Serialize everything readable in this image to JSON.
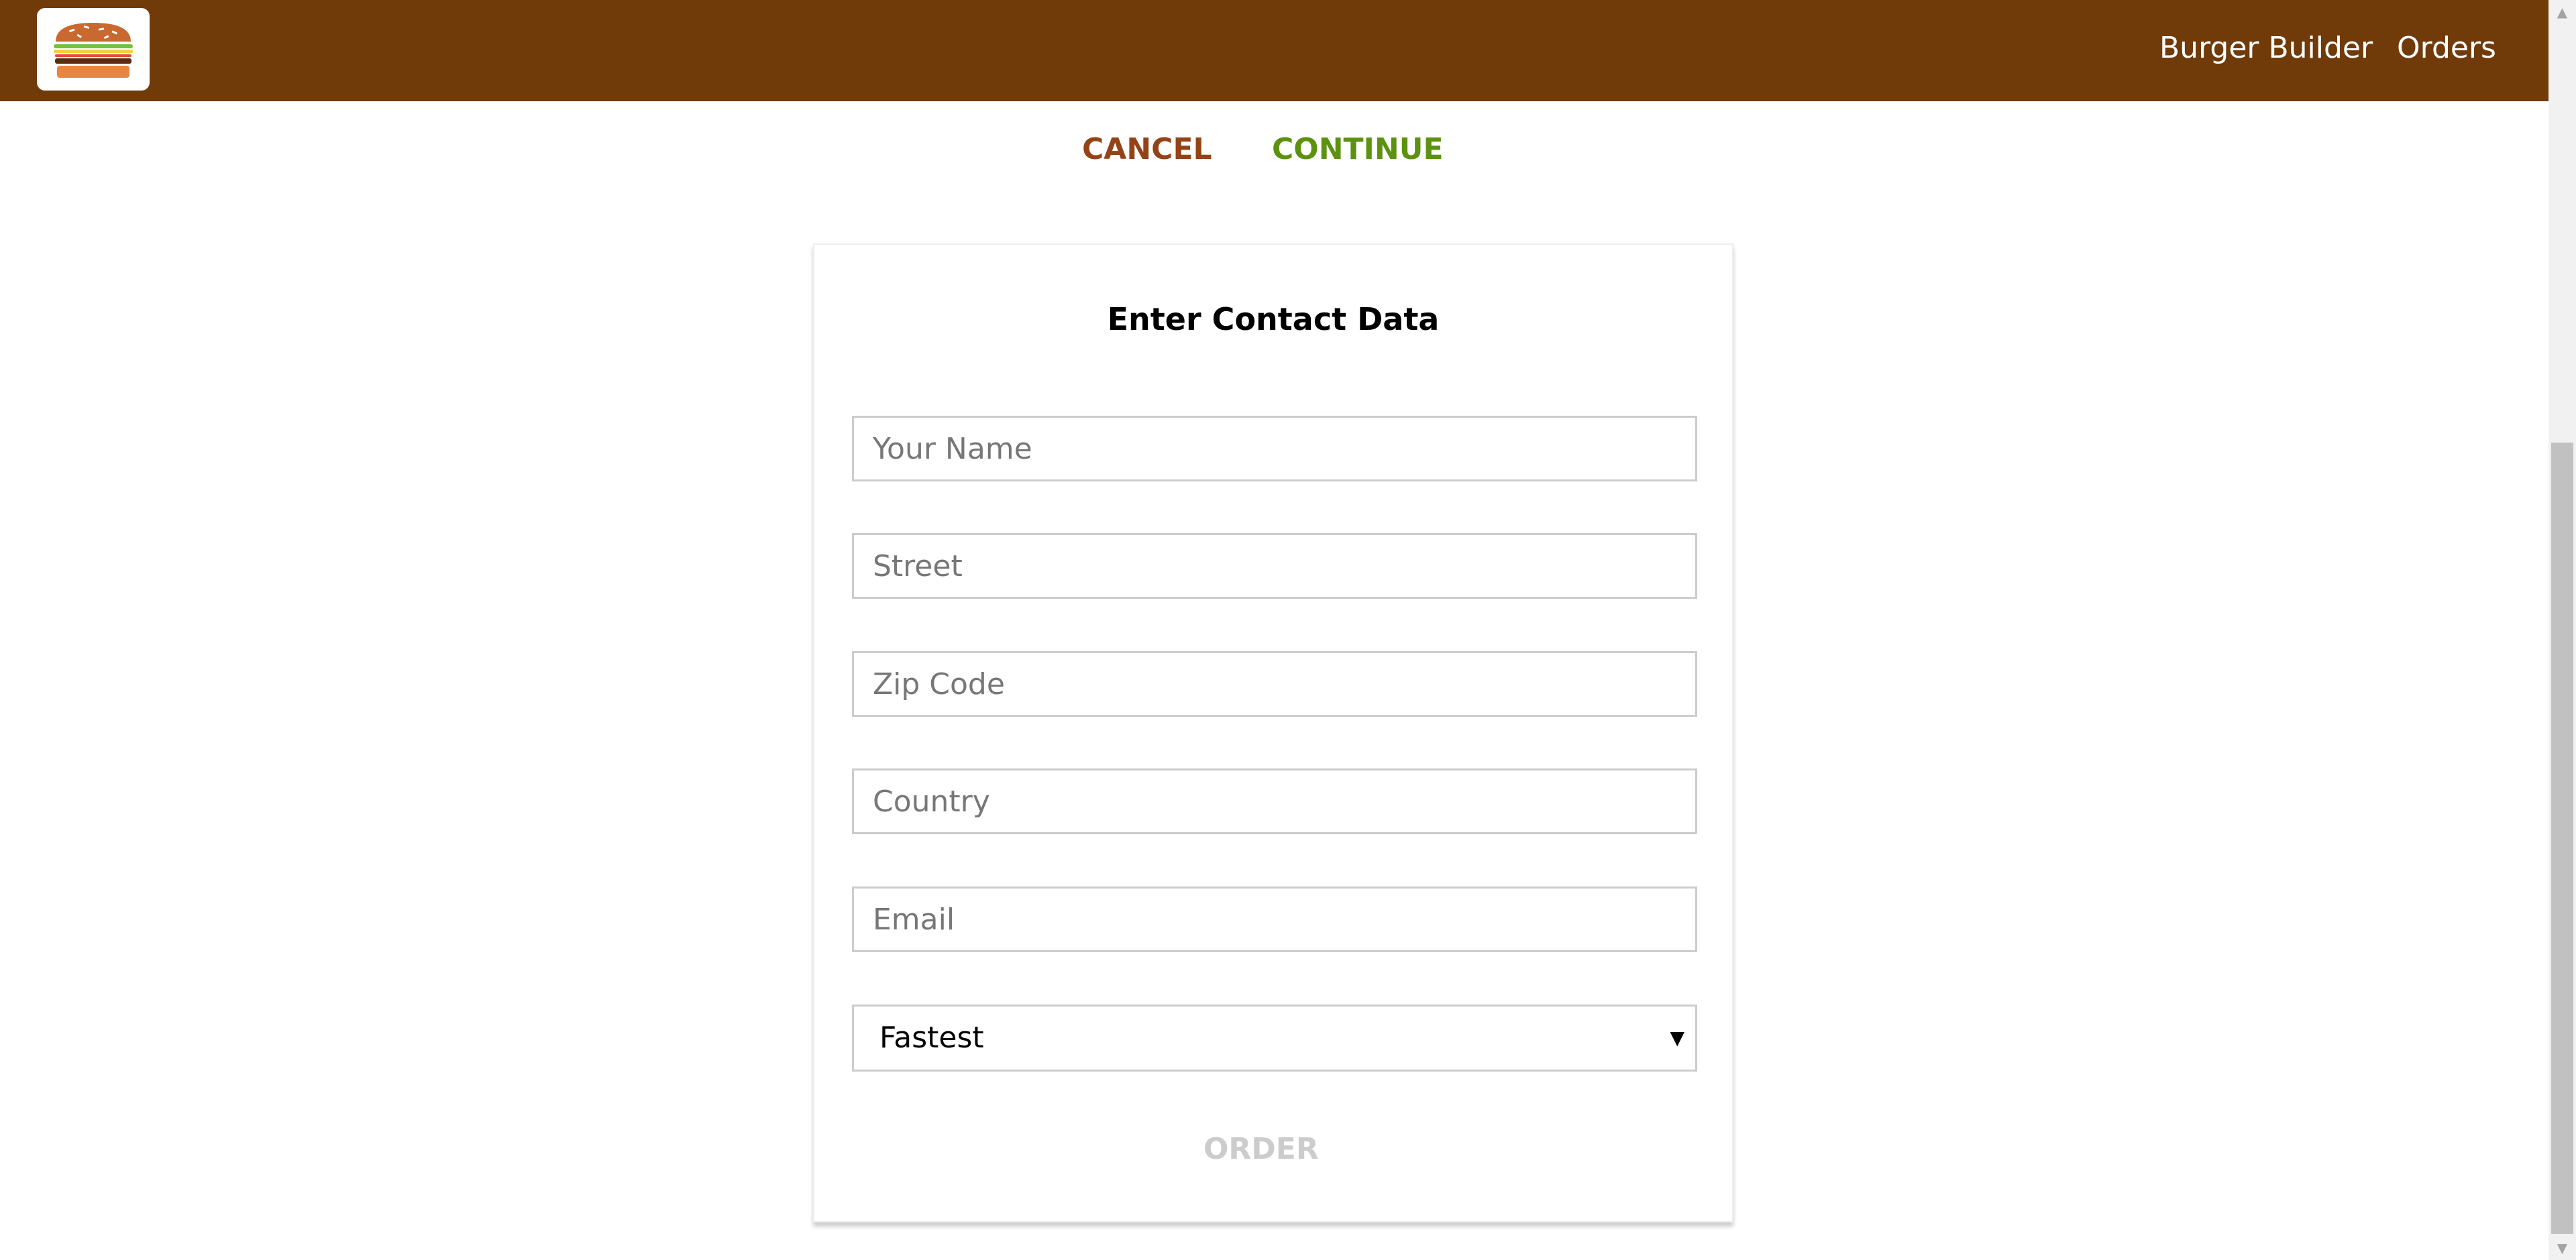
{
  "header": {
    "logo_icon": "burger-logo-icon",
    "nav": [
      {
        "label": "Burger Builder"
      },
      {
        "label": "Orders"
      }
    ],
    "background": "#703b09"
  },
  "actions": {
    "cancel_label": "CANCEL",
    "continue_label": "CONTINUE",
    "cancel_color": "#944317",
    "continue_color": "#5c9210"
  },
  "form": {
    "title": "Enter Contact Data",
    "fields": [
      {
        "placeholder": "Your Name",
        "value": ""
      },
      {
        "placeholder": "Street",
        "value": ""
      },
      {
        "placeholder": "Zip Code",
        "value": ""
      },
      {
        "placeholder": "Country",
        "value": ""
      },
      {
        "placeholder": "Email",
        "value": ""
      }
    ],
    "delivery": {
      "selected": "Fastest",
      "arrow_icon": "caret-down-icon"
    },
    "order_label": "ORDER",
    "order_disabled": true
  },
  "scrollbar": {
    "up_icon": "scroll-up-arrow-icon",
    "down_icon": "scroll-down-arrow-icon"
  }
}
